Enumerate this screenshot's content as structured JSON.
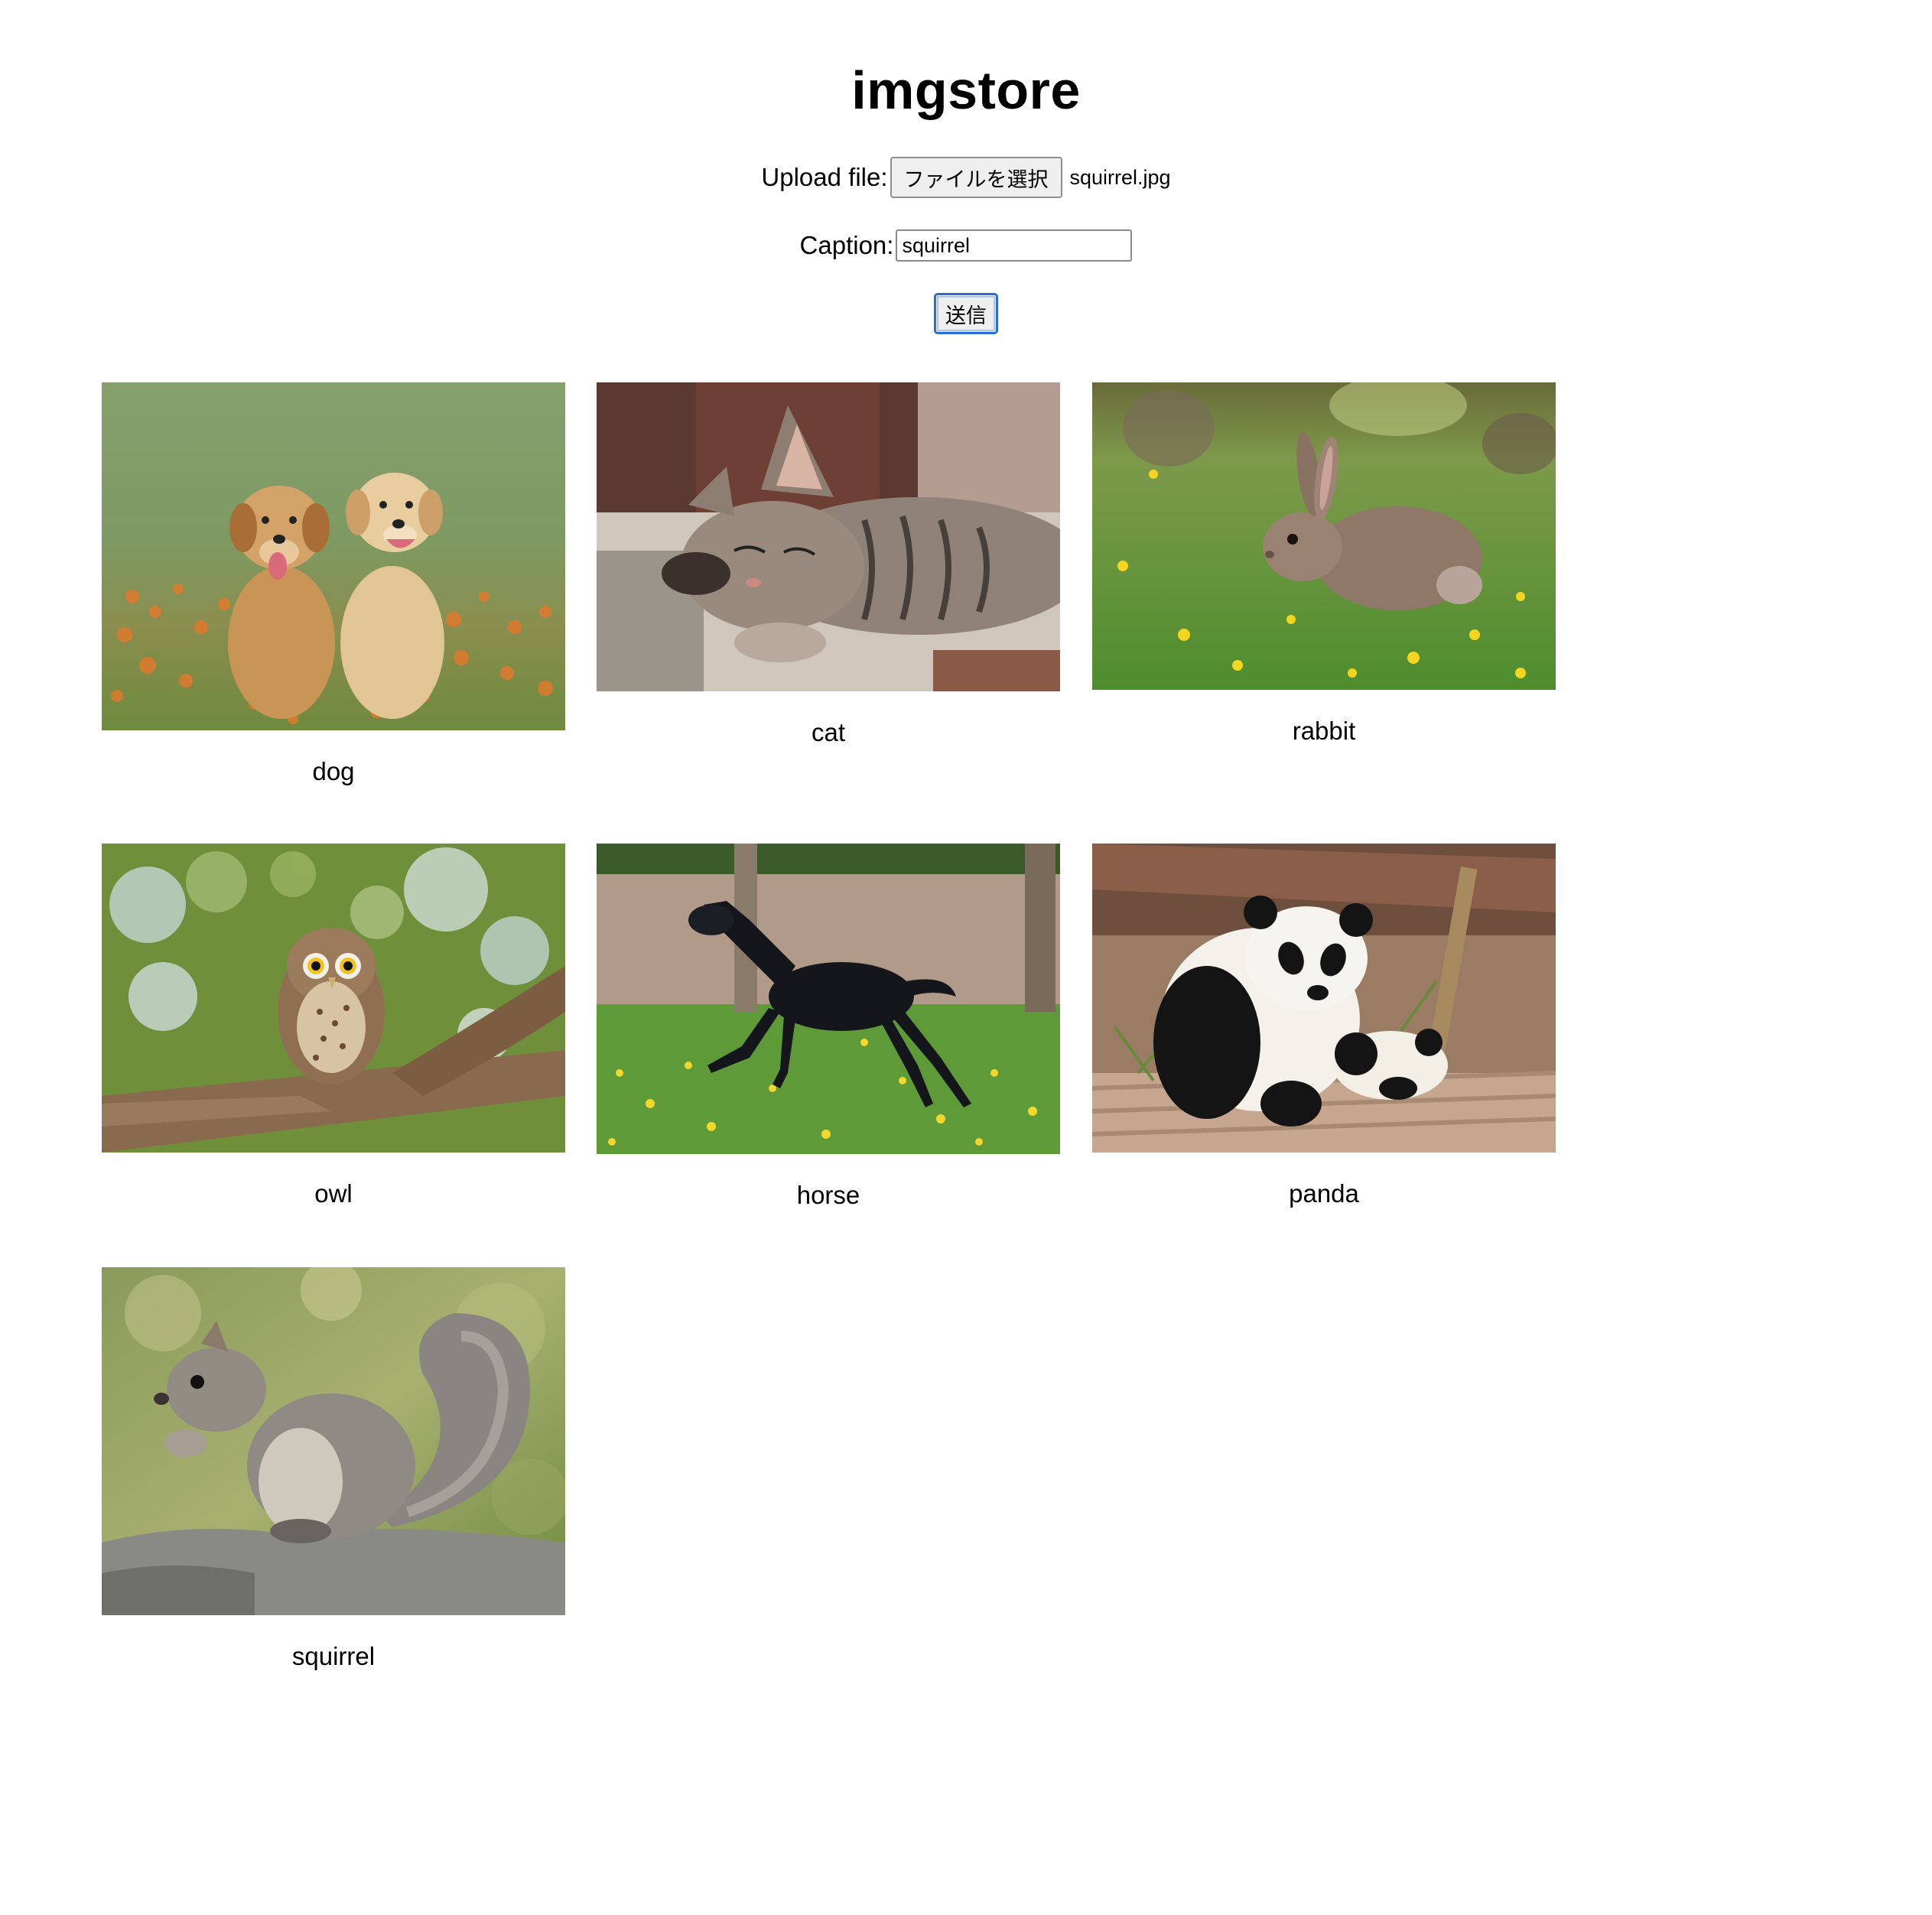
{
  "app": {
    "title": "imgstore"
  },
  "form": {
    "upload_label": "Upload file:",
    "file_button_label": "ファイルを選択",
    "file_name": "squirrel.jpg",
    "caption_label": "Caption:",
    "caption_value": "squirrel",
    "submit_label": "送信"
  },
  "gallery": {
    "items": [
      {
        "caption": "dog",
        "subject": "two golden retriever puppies in a flower field"
      },
      {
        "caption": "cat",
        "subject": "sleeping tabby kitten"
      },
      {
        "caption": "rabbit",
        "subject": "brown rabbit on green grass"
      },
      {
        "caption": "owl",
        "subject": "small owl perched on a branch"
      },
      {
        "caption": "horse",
        "subject": "black foal running on grass"
      },
      {
        "caption": "panda",
        "subject": "giant panda with cub"
      },
      {
        "caption": "squirrel",
        "subject": "gray squirrel on a rock"
      }
    ]
  }
}
